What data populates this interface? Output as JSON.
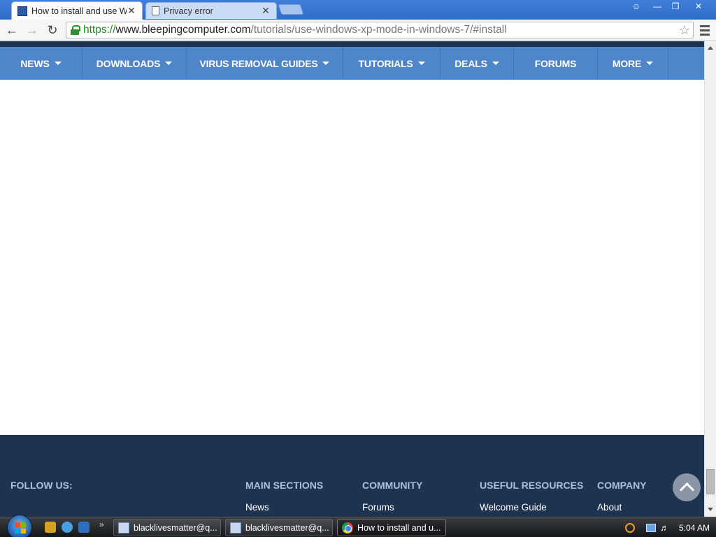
{
  "browser": {
    "tabs": [
      {
        "title": "How to install and use Wi",
        "active": true
      },
      {
        "title": "Privacy error",
        "active": false
      }
    ],
    "address": {
      "scheme": "https://",
      "host": "www.bleepingcomputer.com",
      "path": "/tutorials/use-windows-xp-mode-in-windows-7/#install"
    }
  },
  "site": {
    "nav": [
      {
        "label": "NEWS",
        "dropdown": true
      },
      {
        "label": "DOWNLOADS",
        "dropdown": true
      },
      {
        "label": "VIRUS REMOVAL GUIDES",
        "dropdown": true
      },
      {
        "label": "TUTORIALS",
        "dropdown": true
      },
      {
        "label": "DEALS",
        "dropdown": true
      },
      {
        "label": "FORUMS",
        "dropdown": false
      },
      {
        "label": "MORE",
        "dropdown": true
      }
    ],
    "footer": {
      "follow_us": "FOLLOW US:",
      "columns": [
        {
          "heading": "MAIN SECTIONS",
          "first_link": "News"
        },
        {
          "heading": "COMMUNITY",
          "first_link": "Forums"
        },
        {
          "heading": "USEFUL RESOURCES",
          "first_link": "Welcome Guide"
        },
        {
          "heading": "COMPANY",
          "first_link": "About"
        }
      ]
    }
  },
  "taskbar": {
    "items": [
      {
        "label": "blacklivesmatter@q...",
        "icon": "document-icon"
      },
      {
        "label": "blacklivesmatter@q...",
        "icon": "document-icon"
      },
      {
        "label": "How to install and u...",
        "icon": "chrome-icon"
      }
    ],
    "clock": "5:04 AM"
  }
}
